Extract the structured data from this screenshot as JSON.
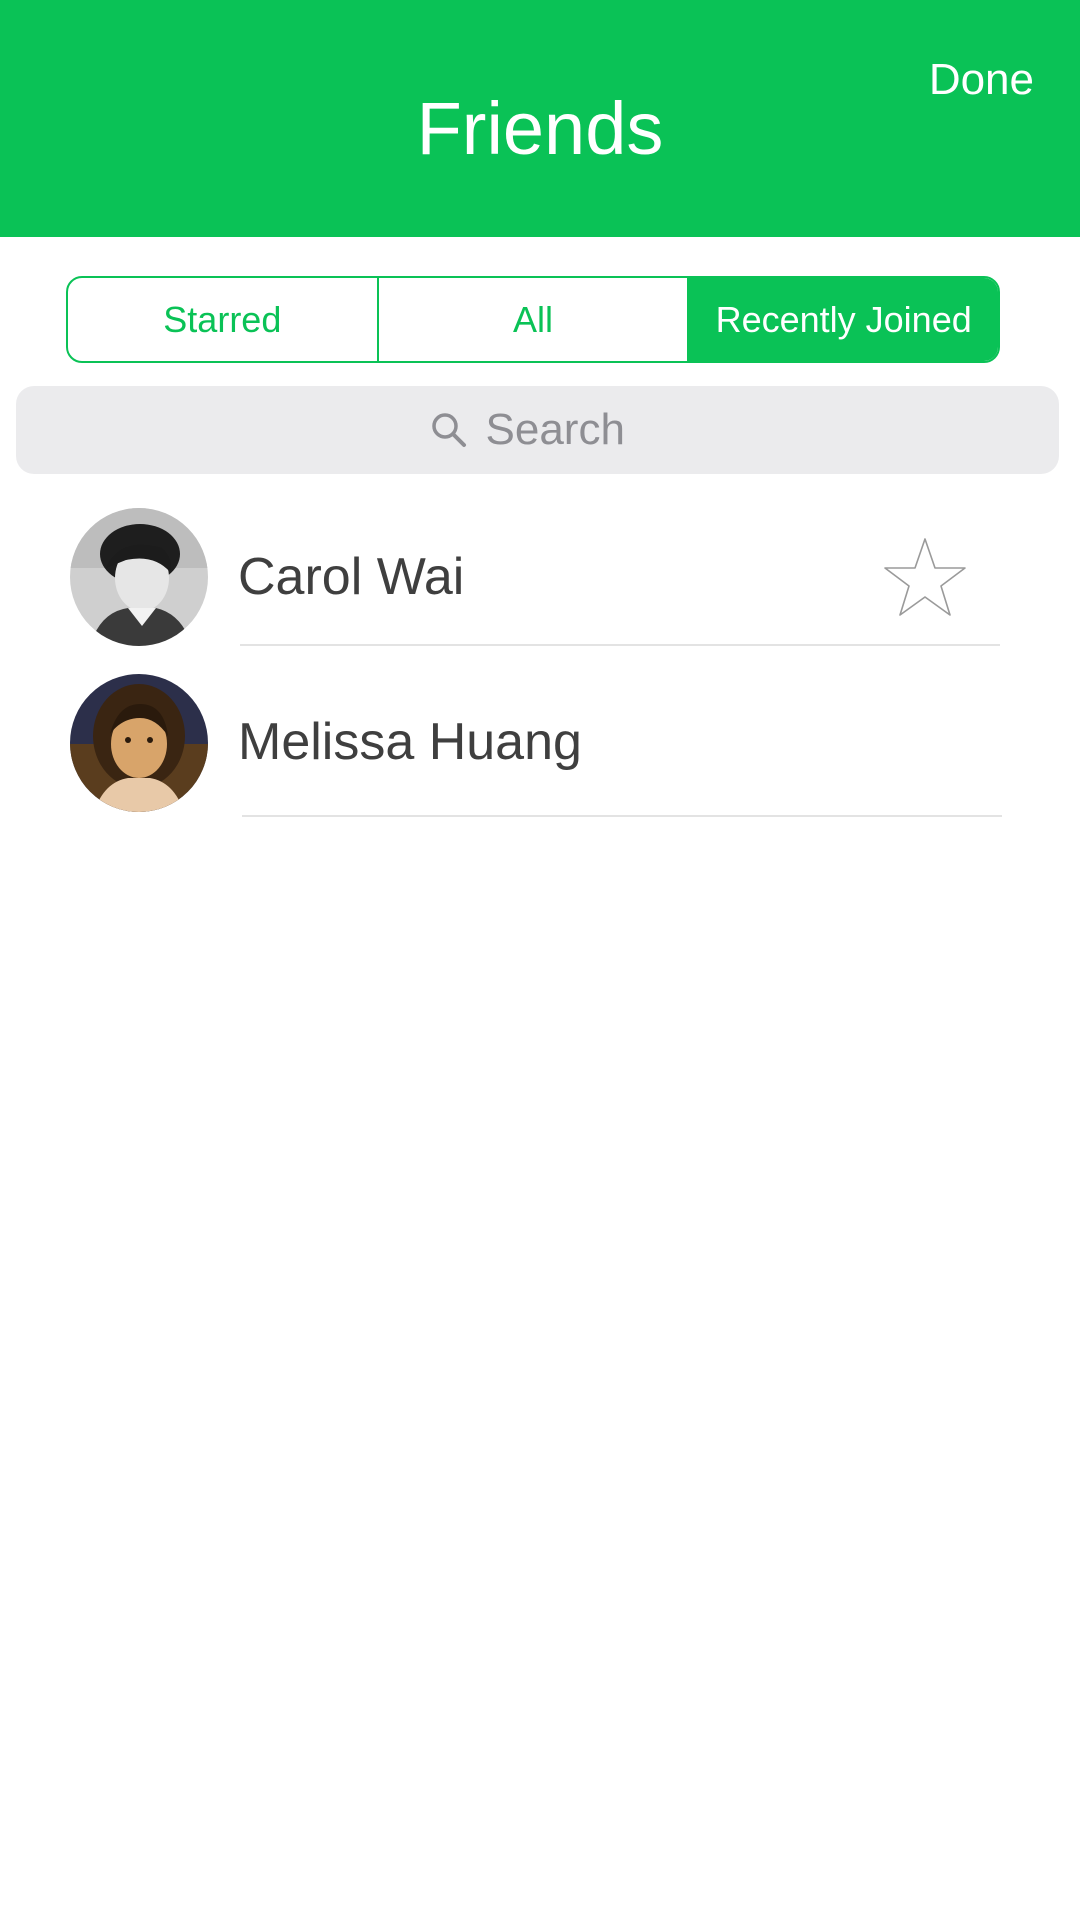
{
  "header": {
    "title": "Friends",
    "done_label": "Done"
  },
  "segments": [
    {
      "label": "Starred",
      "active": false
    },
    {
      "label": "All",
      "active": false
    },
    {
      "label": "Recently Joined",
      "active": true
    }
  ],
  "search": {
    "placeholder": "Search",
    "icon": "search-icon"
  },
  "friends": [
    {
      "name": "Carol Wai",
      "starred": false,
      "star_icon": "star-outline-icon"
    },
    {
      "name": "Melissa Huang"
    }
  ],
  "colors": {
    "accent": "#0ac256",
    "search_bg": "#ebebed",
    "text": "#3f3f3f",
    "placeholder": "#8e8e93"
  }
}
